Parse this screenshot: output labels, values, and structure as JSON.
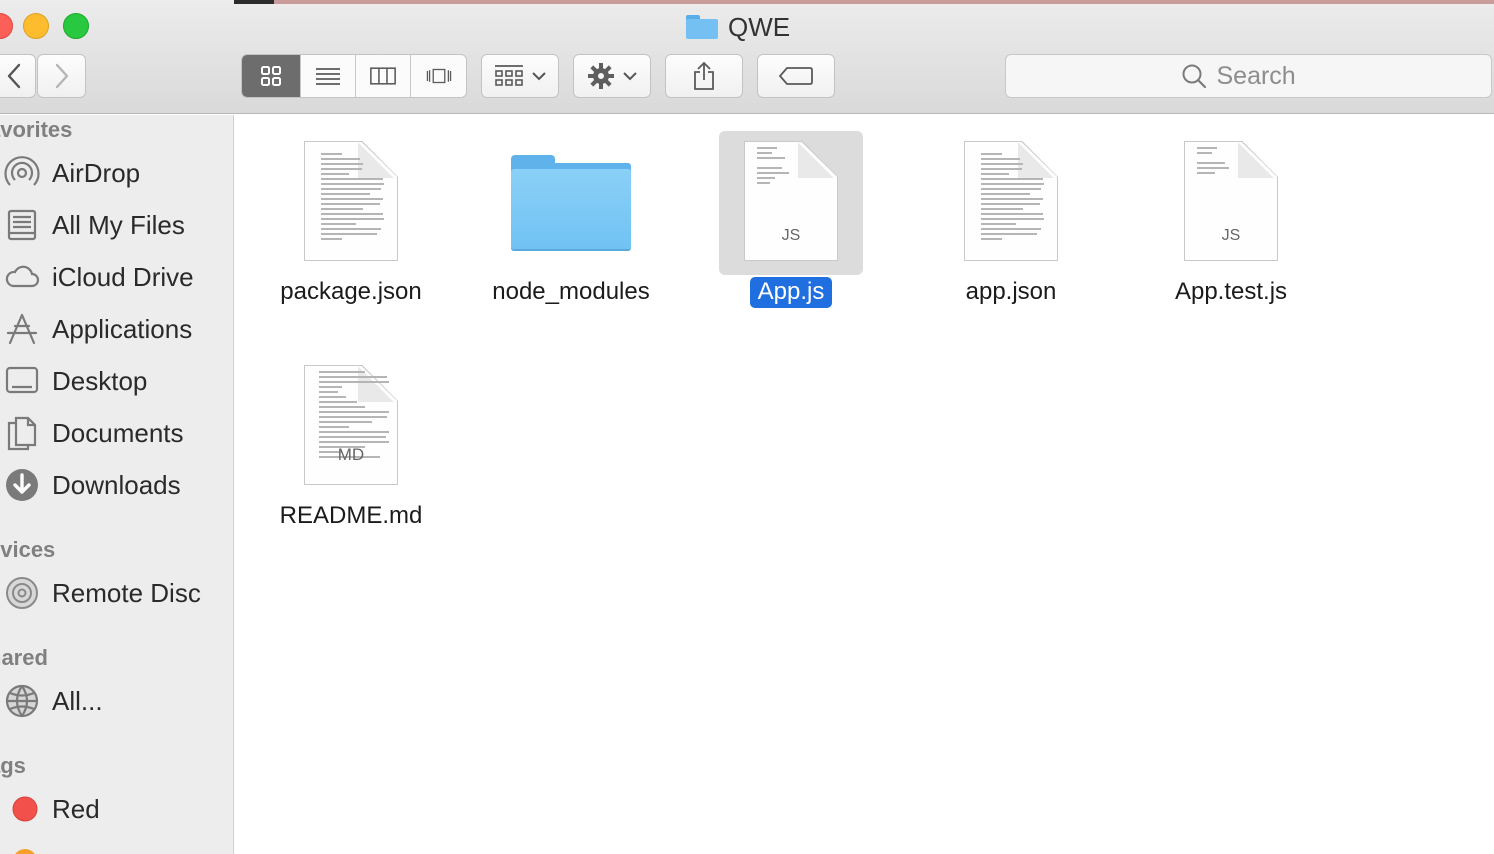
{
  "window": {
    "title": "QWE"
  },
  "toolbar": {
    "view_modes": [
      "icon",
      "list",
      "column",
      "cover-flow"
    ],
    "active_view": "icon",
    "search_placeholder": "Search"
  },
  "sidebar": {
    "sections": {
      "favorites": "avorites",
      "devices": "evices",
      "shared": "hared",
      "tags": "ags"
    },
    "favorites": [
      {
        "label": "AirDrop",
        "icon": "airdrop-icon"
      },
      {
        "label": "All My Files",
        "icon": "all-files-icon"
      },
      {
        "label": "iCloud Drive",
        "icon": "cloud-icon"
      },
      {
        "label": "Applications",
        "icon": "applications-icon"
      },
      {
        "label": "Desktop",
        "icon": "desktop-icon"
      },
      {
        "label": "Documents",
        "icon": "documents-icon"
      },
      {
        "label": "Downloads",
        "icon": "downloads-icon"
      }
    ],
    "devices": [
      {
        "label": "Remote Disc",
        "icon": "disc-icon"
      }
    ],
    "shared": [
      {
        "label": "All...",
        "icon": "network-icon"
      }
    ],
    "tags": [
      {
        "label": "Red",
        "color": "#f2514b"
      },
      {
        "label": "",
        "color": "#f59f2d"
      }
    ]
  },
  "files": [
    {
      "name": "package.json",
      "kind": "text",
      "ext": ""
    },
    {
      "name": "node_modules",
      "kind": "folder",
      "ext": ""
    },
    {
      "name": "App.js",
      "kind": "js",
      "ext": "JS",
      "selected": true
    },
    {
      "name": "app.json",
      "kind": "text",
      "ext": ""
    },
    {
      "name": "App.test.js",
      "kind": "js",
      "ext": "JS"
    },
    {
      "name": "README.md",
      "kind": "md",
      "ext": "MD"
    }
  ],
  "colors": {
    "selection": "#1f6fe0",
    "folder": "#75c0f2",
    "tag_red": "#f2514b"
  }
}
